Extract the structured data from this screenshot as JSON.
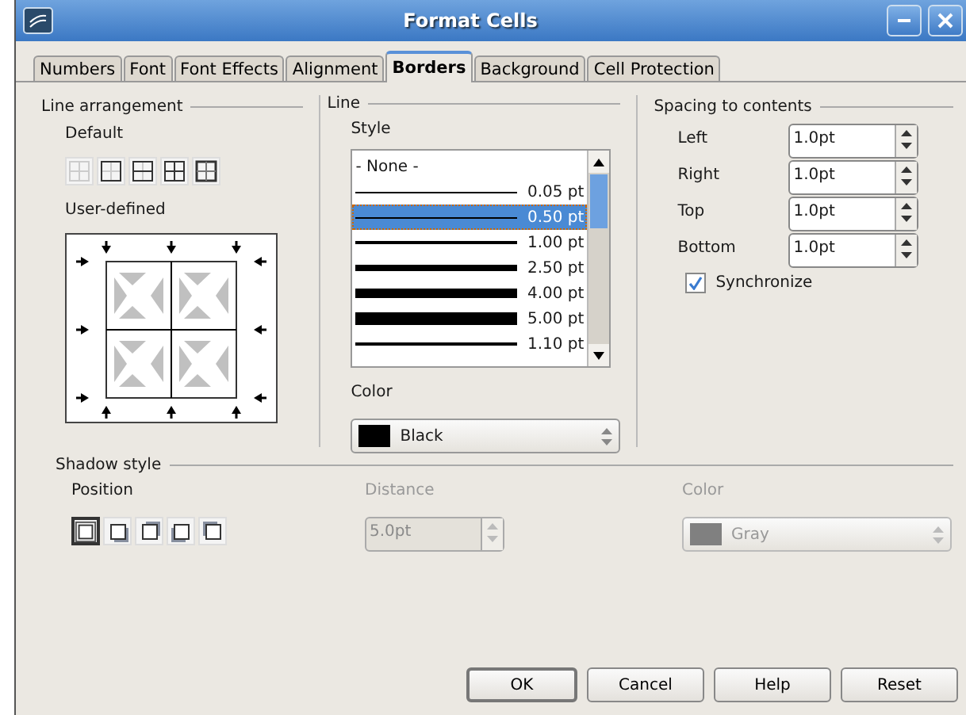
{
  "window": {
    "title": "Format Cells"
  },
  "tabs": [
    {
      "label": "Numbers",
      "selected": false
    },
    {
      "label": "Font",
      "selected": false
    },
    {
      "label": "Font Effects",
      "selected": false
    },
    {
      "label": "Alignment",
      "selected": false
    },
    {
      "label": "Borders",
      "selected": true
    },
    {
      "label": "Background",
      "selected": false
    },
    {
      "label": "Cell Protection",
      "selected": false
    }
  ],
  "line_arrangement": {
    "title": "Line arrangement",
    "default_label": "Default",
    "presets": [
      {
        "kind": "none",
        "selected": false
      },
      {
        "kind": "outer",
        "selected": false
      },
      {
        "kind": "outer-horizontal",
        "selected": false
      },
      {
        "kind": "all",
        "selected": false
      },
      {
        "kind": "outer-inner",
        "selected": false
      }
    ],
    "user_defined_label": "User-defined"
  },
  "line": {
    "title": "Line",
    "style_label": "Style",
    "styles": [
      {
        "kind": "none",
        "label": "- None -",
        "selected": false
      },
      {
        "kind": "hair",
        "label": "0.05 pt",
        "selected": false
      },
      {
        "kind": "thin",
        "label": "0.50 pt",
        "selected": true
      },
      {
        "kind": "medium",
        "label": "1.00 pt",
        "selected": false
      },
      {
        "kind": "bold",
        "label": "2.50 pt",
        "selected": false
      },
      {
        "kind": "heavy",
        "label": "4.00 pt",
        "selected": false
      },
      {
        "kind": "heavier",
        "label": "5.00 pt",
        "selected": false
      },
      {
        "kind": "cut",
        "label": "1.10 pt",
        "selected": false
      }
    ],
    "color_label": "Color",
    "color": {
      "name": "Black",
      "color": "#000000"
    }
  },
  "spacing": {
    "title": "Spacing to contents",
    "fields": [
      {
        "label": "Left",
        "value": "1.0pt"
      },
      {
        "label": "Right",
        "value": "1.0pt"
      },
      {
        "label": "Top",
        "value": "1.0pt"
      },
      {
        "label": "Bottom",
        "value": "1.0pt"
      }
    ],
    "synchronize": {
      "label": "Synchronize",
      "checked": true
    }
  },
  "shadow": {
    "title": "Shadow style",
    "position_label": "Position",
    "positions": [
      {
        "kind": "none",
        "selected": true
      },
      {
        "kind": "bottom-right",
        "selected": false
      },
      {
        "kind": "top-right",
        "selected": false
      },
      {
        "kind": "bottom-left",
        "selected": false
      },
      {
        "kind": "top-left",
        "selected": false
      }
    ],
    "distance": {
      "label": "Distance",
      "value": "5.0pt",
      "disabled": true
    },
    "color": {
      "label": "Color",
      "name": "Gray",
      "color": "#808080",
      "disabled": true
    }
  },
  "buttons": [
    {
      "label": "OK"
    },
    {
      "label": "Cancel"
    },
    {
      "label": "Help"
    },
    {
      "label": "Reset"
    }
  ]
}
